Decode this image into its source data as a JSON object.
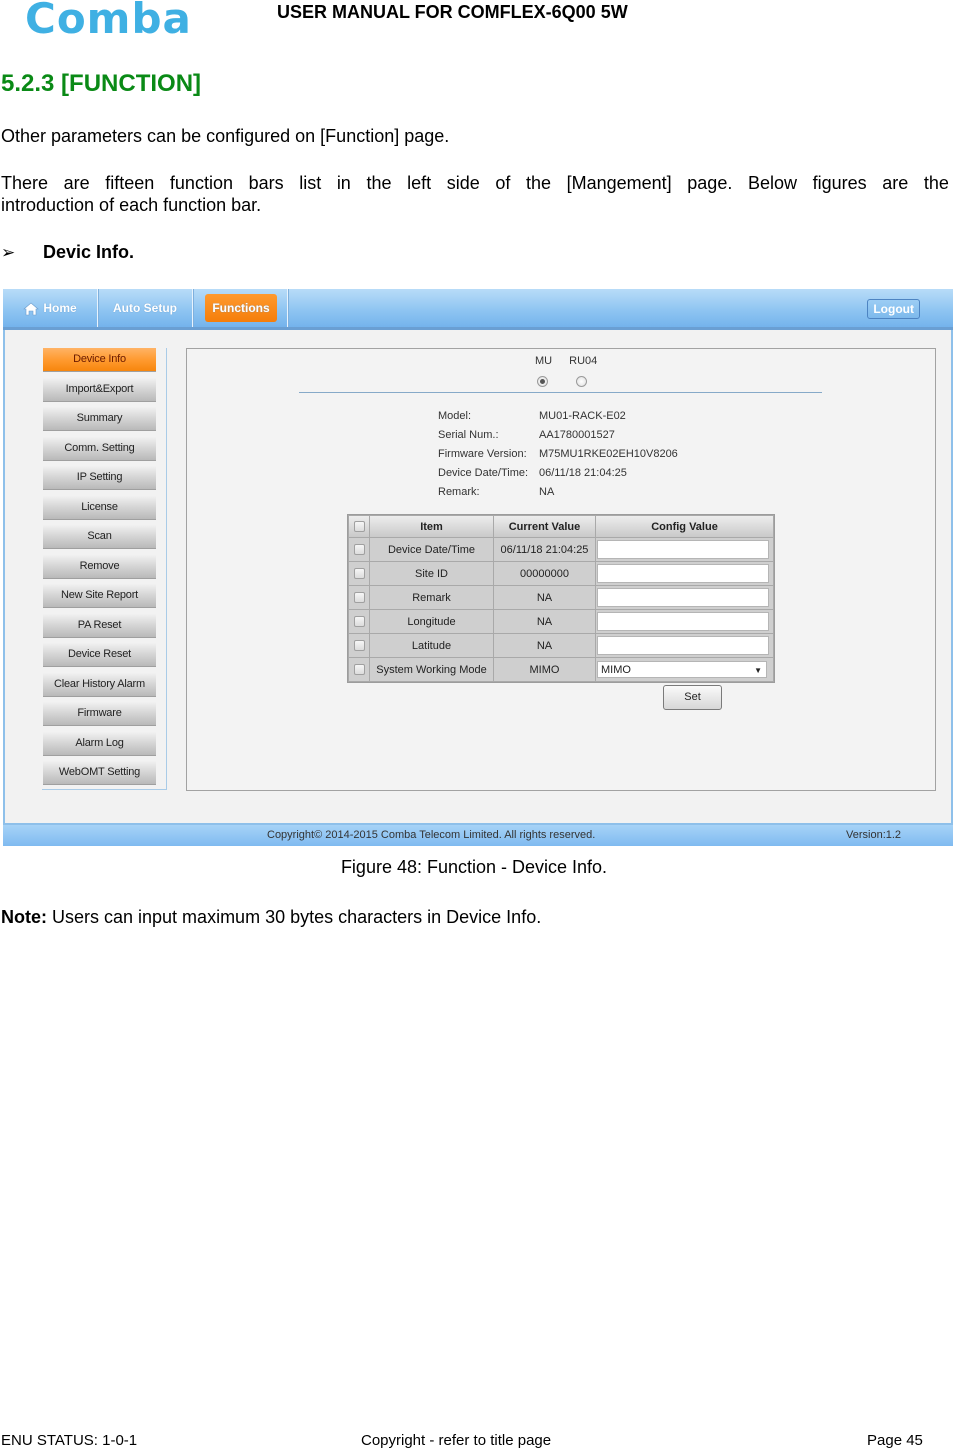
{
  "document": {
    "logo": "Comba",
    "title": "USER MANUAL FOR COMFLEX-6Q00 5W",
    "section_heading": "5.2.3  [FUNCTION]",
    "paragraph1": "Other parameters can be configured on [Function] page.",
    "paragraph2_line1_words": [
      "There",
      "are",
      "fifteen",
      "function",
      "bars",
      "list",
      "in",
      "the",
      "left",
      "side",
      "of",
      "the",
      "[Mangement]",
      "page.",
      "Below",
      "figures",
      "are",
      "the"
    ],
    "paragraph2_line2": "introduction of each function bar.",
    "bullet_marker": "➢",
    "bullet_text": "Devic Info.",
    "caption": "Figure 48: Function - Device Info.",
    "note_label": "Note:",
    "note_text": " Users can input maximum 30 bytes characters in Device Info.",
    "footer": {
      "left": "ENU STATUS: 1-0-1",
      "center": "Copyright - refer to title page",
      "right": "Page 45"
    }
  },
  "app": {
    "nav": {
      "tabs": [
        {
          "label": "Home",
          "icon": "home-icon"
        },
        {
          "label": "Auto Setup"
        },
        {
          "label": "Functions",
          "active": true
        }
      ],
      "logout_label": "Logout"
    },
    "sidebar": {
      "items": [
        {
          "label": "Device Info",
          "active": true
        },
        {
          "label": "Import&Export"
        },
        {
          "label": "Summary"
        },
        {
          "label": "Comm. Setting"
        },
        {
          "label": "IP Setting"
        },
        {
          "label": "License"
        },
        {
          "label": "Scan"
        },
        {
          "label": "Remove"
        },
        {
          "label": "New Site Report"
        },
        {
          "label": "PA Reset"
        },
        {
          "label": "Device Reset"
        },
        {
          "label": "Clear History Alarm"
        },
        {
          "label": "Firmware"
        },
        {
          "label": "Alarm Log"
        },
        {
          "label": "WebOMT Setting"
        }
      ]
    },
    "device_select": {
      "options": [
        "MU",
        "RU04"
      ],
      "selected": "MU"
    },
    "info": [
      {
        "key": "Model:",
        "value": "MU01-RACK-E02"
      },
      {
        "key": "Serial Num.:",
        "value": "AA1780001527"
      },
      {
        "key": "Firmware Version:",
        "value": "M75MU1RKE02EH10V8206"
      },
      {
        "key": "Device Date/Time:",
        "value": "06/11/18 21:04:25"
      },
      {
        "key": "Remark:",
        "value": "NA"
      }
    ],
    "table": {
      "headers": [
        "Item",
        "Current Value",
        "Config Value"
      ],
      "rows": [
        {
          "item": "Device Date/Time",
          "current": "06/11/18 21:04:25",
          "config": ""
        },
        {
          "item": "Site ID",
          "current": "00000000",
          "config": ""
        },
        {
          "item": "Remark",
          "current": "NA",
          "config": ""
        },
        {
          "item": "Longitude",
          "current": "NA",
          "config": ""
        },
        {
          "item": "Latitude",
          "current": "NA",
          "config": ""
        },
        {
          "item": "System Working Mode",
          "current": "MIMO",
          "config": "MIMO"
        }
      ]
    },
    "set_label": "Set",
    "footer": {
      "copyright": "Copyright© 2014-2015 Comba Telecom Limited. All rights reserved.",
      "version": "Version:1.2"
    }
  }
}
